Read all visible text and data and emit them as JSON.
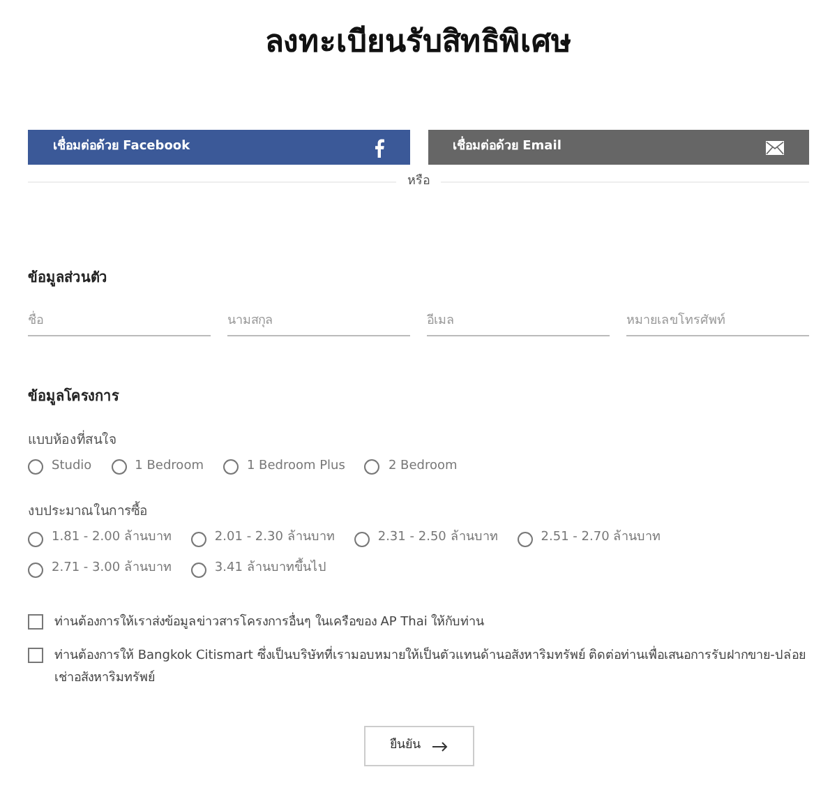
{
  "title": "ลงทะเบียนรับสิทธิพิเศษ",
  "social_buttons": [
    {
      "kind": "facebook",
      "label": "เชื่อมต่อด้วย Facebook"
    },
    {
      "kind": "email",
      "label": "เชื่อมต่อด้วย Email"
    }
  ],
  "divider_text": "หรือ",
  "personal": {
    "heading": "ข้อมูลส่วนตัว",
    "fields": [
      {
        "placeholder": "ชื่อ"
      },
      {
        "placeholder": "นามสกุล"
      },
      {
        "placeholder": "อีเมล"
      },
      {
        "placeholder": "หมายเลขโทรศัพท์"
      }
    ]
  },
  "project": {
    "heading": "ข้อมูลโครงการ",
    "groups": [
      {
        "label": "แบบห้องที่สนใจ",
        "options": [
          {
            "label": "Studio",
            "selected": false
          },
          {
            "label": "1 Bedroom",
            "selected": false
          },
          {
            "label": "1 Bedroom Plus",
            "selected": false
          },
          {
            "label": "2 Bedroom",
            "selected": false
          }
        ]
      },
      {
        "label": "งบประมาณในการซื้อ",
        "options": [
          {
            "label": "1.81 - 2.00 ล้านบาท",
            "selected": false
          },
          {
            "label": "2.01 - 2.30 ล้านบาท",
            "selected": false
          },
          {
            "label": "2.31 - 2.50 ล้านบาท",
            "selected": false
          },
          {
            "label": "2.51 - 2.70 ล้านบาท",
            "selected": false
          },
          {
            "label": "2.71 - 3.00 ล้านบาท",
            "selected": false
          },
          {
            "label": "3.41 ล้านบาทขึ้นไป",
            "selected": false
          }
        ]
      }
    ]
  },
  "consents": [
    {
      "label": "ท่านต้องการให้เราส่งข้อมูลข่าวสารโครงการอื่นๆ ในเครือของ AP Thai ให้กับท่าน",
      "checked": false
    },
    {
      "label": "ท่านต้องการให้ Bangkok Citismart ซึ่งเป็นบริษัทที่เรามอบหมายให้เป็นตัวแทนด้านอสังหาริมทรัพย์ ติดต่อท่านเพื่อเสนอการรับฝากขาย-ปล่อยเช่าอสังหาริมทรัพย์",
      "checked": false
    }
  ],
  "submit": {
    "label": "ยืนยัน"
  }
}
